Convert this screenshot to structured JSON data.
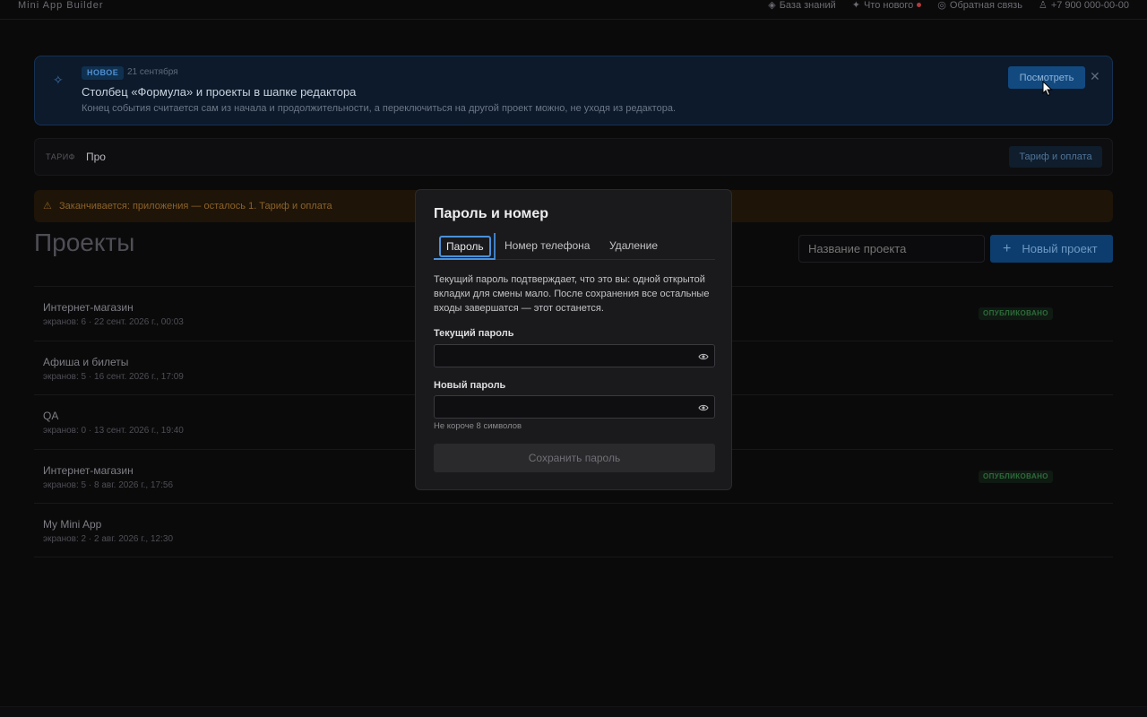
{
  "topbar": {
    "brand": "Mini App Builder",
    "links": [
      {
        "label": "База знаний"
      },
      {
        "label": "Что нового"
      },
      {
        "label": "Обратная связь"
      },
      {
        "label": "+7 900 000-00-00"
      }
    ]
  },
  "news": {
    "badge": "НОВОЕ",
    "date": "21 сентября",
    "title": "Столбец «Формула» и проекты в шапке редактора",
    "description": "Конец события считается сам из начала и продолжительности, а переключиться на другой проект можно, не уходя из редактора.",
    "view_label": "Посмотреть",
    "close_label": "✕"
  },
  "tariff": {
    "label": "ТАРИФ",
    "value": "Про",
    "pay_label": "Тариф и оплата"
  },
  "warning": {
    "icon": "⚠",
    "text": "Заканчивается: приложения — осталось 1. Тариф и оплата"
  },
  "projects": {
    "title": "Проекты",
    "search_placeholder": "Название проекта",
    "new_label": "Новый проект",
    "items": [
      {
        "name": "Интернет-магазин",
        "meta": "экранов: 6 · 22 сент. 2026 г., 00:03",
        "badge": "ОПУБЛИКОВАНО"
      },
      {
        "name": "Афиша и билеты",
        "meta": "экранов: 5 · 16 сент. 2026 г., 17:09",
        "badge": ""
      },
      {
        "name": "QA",
        "meta": "экранов: 0 · 13 сент. 2026 г., 19:40",
        "badge": ""
      },
      {
        "name": "Интернет-магазин",
        "meta": "экранов: 5 · 8 авг. 2026 г., 17:56",
        "badge": "ОПУБЛИКОВАНО"
      },
      {
        "name": "My Mini App",
        "meta": "экранов: 2 · 2 авг. 2026 г., 12:30",
        "badge": ""
      }
    ]
  },
  "modal": {
    "title": "Пароль и номер",
    "tabs": [
      {
        "label": "Пароль"
      },
      {
        "label": "Номер телефона"
      },
      {
        "label": "Удаление"
      }
    ],
    "description": "Текущий пароль подтверждает, что это вы: одной открытой вкладки для смены мало. После сохранения все остальные входы завершатся — этот останется.",
    "current_label": "Текущий пароль",
    "current_value": "",
    "new_label": "Новый пароль",
    "new_value": "",
    "hint": "Не короче 8 символов",
    "save_label": "Сохранить пароль"
  }
}
